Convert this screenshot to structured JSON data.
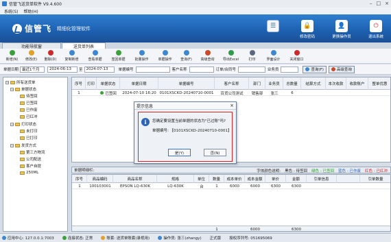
{
  "window": {
    "title": "信管飞送货单软件 V9.4.600"
  },
  "menu": [
    "系统(S)",
    "帮助(H)"
  ],
  "brand": {
    "name": "信管飞",
    "slogan": "精细化管理软件"
  },
  "top_buttons": [
    "",
    "修改密码",
    "更换操作员",
    "退出系统"
  ],
  "tabs": [
    "功能导航窗",
    "送货单列表"
  ],
  "toolbar": [
    "新增(N)",
    "修改(E)",
    "删除(D)",
    "复制新增",
    "查看单据",
    "签回单据",
    "批量操作",
    "单据操作",
    "查询(F)",
    "高级查询",
    "导出Excel",
    "打印",
    "界面设计",
    "关闭窗口"
  ],
  "filter": {
    "date_label": "单据日期",
    "period": "最近1个月",
    "date_from": "2024-06-13",
    "date_to": "2024-07-13",
    "to_label": "至",
    "order_no_label": "单据编号",
    "customer_label": "客户名称",
    "contact_label": "订单/合同号",
    "salesman_label": "业务员",
    "query_btn": "查询(F)",
    "adv_btn": "高级查询"
  },
  "tree": {
    "root": "所有送货单",
    "groups": [
      {
        "label": "单据状态",
        "items": [
          "待签回",
          "已签回",
          "已作废",
          "已红冲"
        ]
      },
      {
        "label": "打印状态",
        "items": [
          "未打印",
          "已打印"
        ]
      },
      {
        "label": "发货方式",
        "items": [
          "第三方物流",
          "公司配送",
          "客户自提",
          "250ML"
        ]
      }
    ]
  },
  "grid": {
    "headers": [
      "序号",
      "打印",
      "单据状态",
      "单据日期",
      "单据编号",
      "客户名称",
      "部门",
      "业务员",
      "总数量",
      "结算方式",
      "本次收款",
      "收款账户",
      "整单优惠"
    ],
    "rows": [
      [
        "1",
        "",
        "已签回",
        "2024-07-10 16:20",
        "0101XSCKD-20240710-0001",
        "百货公司测试",
        "销售部",
        "张三",
        "6",
        "",
        "",
        "",
        ""
      ]
    ]
  },
  "detail_bar": {
    "title": "单据明细栏:",
    "legend_prefix": "字体颜色说明:",
    "legend": [
      {
        "label": "黑色 - 待签回",
        "color": "#222222"
      },
      {
        "label": "绿色 - 已签回",
        "color": "#2e9a2e"
      },
      {
        "label": "蓝色 - 已作废",
        "color": "#2b5fc6"
      },
      {
        "label": "红色 - 已红冲",
        "color": "#cc2222"
      }
    ]
  },
  "detail": {
    "headers": [
      "序号",
      "商品编码",
      "商品名称",
      "规格",
      "单位",
      "数量",
      "成本单价",
      "成本金额",
      "单价",
      "金额",
      "引单信息",
      "",
      "引单数量"
    ],
    "rows": [
      [
        "1",
        "100103001",
        "EPSON LQ-630K",
        "LQ-630K",
        "台",
        "1",
        "6000",
        "6000",
        "6300",
        "6300",
        "",
        "",
        ""
      ]
    ],
    "totals": [
      "",
      "",
      "",
      "",
      "",
      "1",
      "",
      "6000",
      "",
      "6300",
      "",
      "",
      ""
    ]
  },
  "status": [
    "应用中心: 127.0.0.1:7003",
    "连接状态: 正常",
    "账套: 送货单账套(录视用)",
    "操作员: 张三(zhangy)",
    "正式版",
    "授权序列号: 051695069"
  ],
  "dialog": {
    "title": "提示信息",
    "message": "您确定要设置当前单据的状态为\"已过账\"吗?",
    "order_no": "单据编号: 【0101XSCKD-20240710-0001】",
    "yes": "是(Y)",
    "no": "否(N)"
  }
}
